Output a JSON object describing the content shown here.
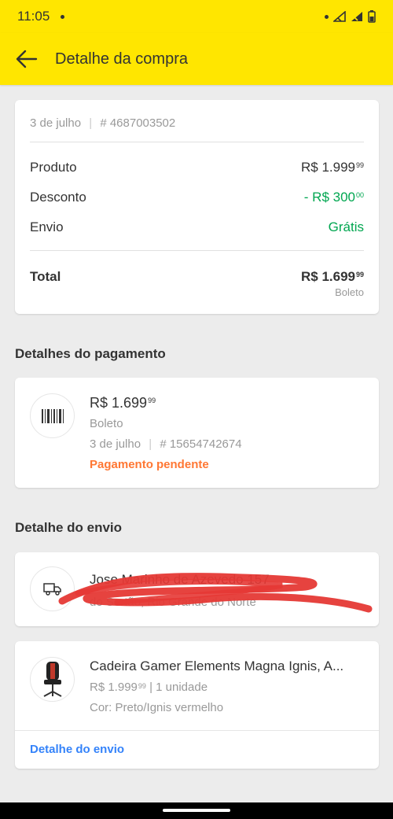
{
  "status_bar": {
    "time": "11:05"
  },
  "header": {
    "title": "Detalhe da compra"
  },
  "summary": {
    "date": "3 de julho",
    "order_number": "# 4687003502",
    "product_label": "Produto",
    "product_value": "R$ 1.999",
    "product_cents": "99",
    "discount_label": "Desconto",
    "discount_value": "- R$ 300",
    "discount_cents": "00",
    "shipping_label": "Envio",
    "shipping_value": "Grátis",
    "total_label": "Total",
    "total_value": "R$ 1.699",
    "total_cents": "99",
    "total_method": "Boleto"
  },
  "payment": {
    "section_title": "Detalhes do pagamento",
    "amount": "R$ 1.699",
    "amount_cents": "99",
    "method": "Boleto",
    "date": "3 de julho",
    "transaction": "# 15654742674",
    "status": "Pagamento pendente"
  },
  "shipping": {
    "section_title": "Detalhe do envio",
    "address_line1": "Jose Marinho de Azevedo 157",
    "address_line2": "do Sertão, Rio Grande do Norte"
  },
  "product": {
    "name": "Cadeira Gamer Elements Magna Ignis, A...",
    "price": "R$ 1.999",
    "price_cents": "99",
    "quantity": "| 1 unidade",
    "color": "Cor: Preto/Ignis vermelho",
    "link": "Detalhe do envio"
  },
  "colors": {
    "brand_yellow": "#ffe600",
    "green": "#00a650",
    "orange": "#ff7733",
    "link_blue": "#3483fa",
    "scribble_red": "#e53935"
  }
}
